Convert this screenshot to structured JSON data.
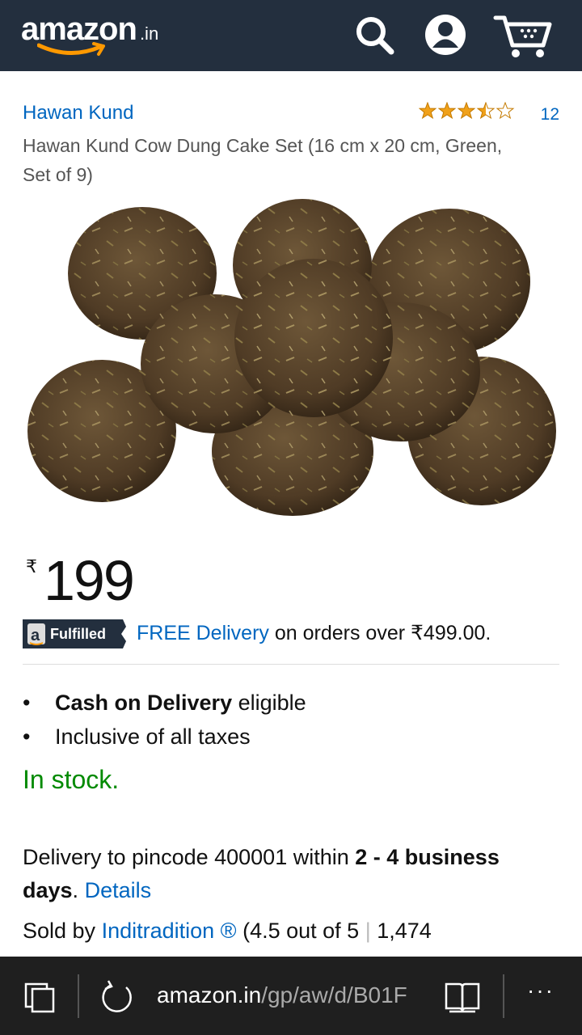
{
  "header": {
    "logo": "amazon",
    "logo_tld": ".in",
    "icons": [
      "search-icon",
      "account-icon",
      "cart-icon"
    ],
    "bg_color": "#232f3e"
  },
  "product": {
    "brand": "Hawan Kund",
    "rating_stars": 3.5,
    "rating_count": "12",
    "title": "Hawan Kund Cow Dung Cake Set (16 cm x 20 cm, Green, Set of 9)",
    "image_icon": "cow-dung-cakes-image"
  },
  "price": {
    "currency": "₹",
    "amount": "199"
  },
  "fulfilled": {
    "badge_a": "a",
    "badge_label": "Fulfilled",
    "free_delivery": "FREE Delivery",
    "delivery_rest": "on orders over ₹499.00."
  },
  "bullets": [
    {
      "bold": "Cash on Delivery",
      "rest": "eligible"
    },
    {
      "bold": "",
      "rest": "Inclusive of all taxes"
    }
  ],
  "bullet_char": "•",
  "stock": "In stock.",
  "delivery": {
    "prefix": "Delivery to pincode 400001 within",
    "bold": "2 - 4 business days",
    "dot": ".",
    "details": "Details"
  },
  "sold_by": {
    "prefix": "Sold by",
    "seller": "Inditradition ®",
    "rating": "(4.5 out of 5",
    "sep": "|",
    "count": "1,474"
  },
  "browser": {
    "url_host": "amazon.in",
    "url_path": "/gp/aw/d/B01F",
    "more": "···",
    "icons": [
      "tabs-icon",
      "refresh-icon",
      "reading-view-icon",
      "more-icon"
    ]
  },
  "colors": {
    "link": "#0066c0",
    "stock": "#008a00",
    "star": "#f0a11a"
  }
}
